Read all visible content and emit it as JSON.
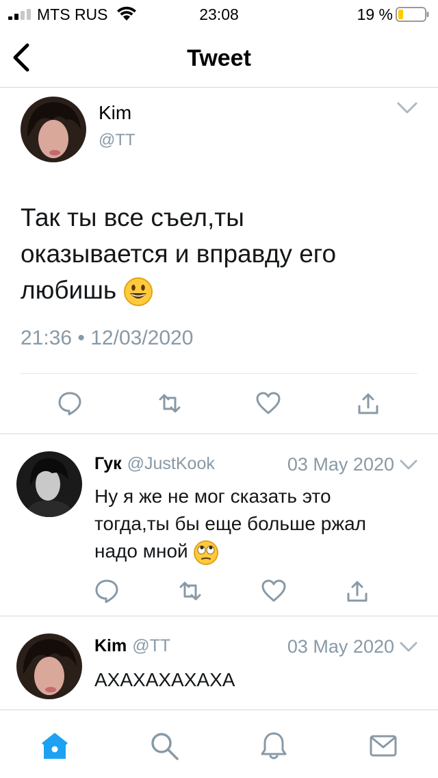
{
  "status_bar": {
    "carrier": "MTS RUS",
    "time": "23:08",
    "battery": "19 %",
    "battery_level": 0.19
  },
  "nav": {
    "title": "Tweet"
  },
  "main_tweet": {
    "name": "Kim",
    "handle": "@TT",
    "text_lines": [
      "Так ты все съел,ты",
      "оказывается и вправду его",
      "любишь"
    ],
    "emoji": "smiling-face",
    "timestamp": "21:36 • 12/03/2020"
  },
  "replies": [
    {
      "name": "Гук",
      "handle": "@JustKook",
      "date": "03 May 2020",
      "text_lines": [
        "Ну я же не мог сказать это",
        "тогда,ты бы еще больше ржал",
        "надо мной"
      ],
      "emoji": "eye-roll-face"
    },
    {
      "name": "Kim",
      "handle": "@TT",
      "date": "03 May 2020",
      "text_lines": [
        "АХАХАХАХАХА"
      ]
    }
  ],
  "icons": {
    "reply": "reply-icon",
    "retweet": "retweet-icon",
    "like": "heart-icon",
    "share": "share-icon",
    "home": "home-icon",
    "search": "search-icon",
    "notifications": "bell-icon",
    "messages": "mail-icon"
  },
  "colors": {
    "accent": "#1da1f2",
    "muted": "#8899a6",
    "battery": "#ffcc00"
  }
}
